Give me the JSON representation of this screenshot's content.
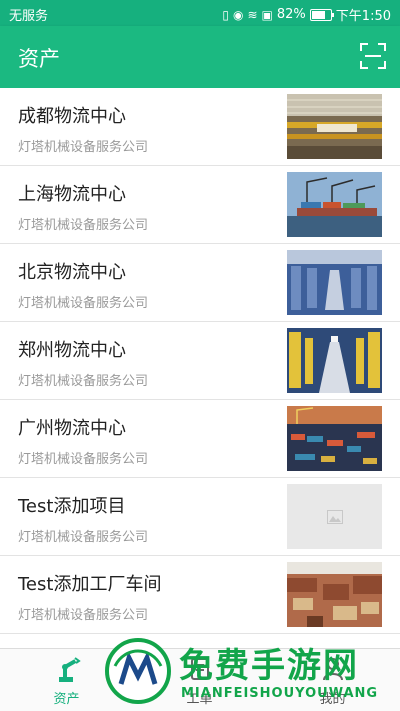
{
  "status_bar": {
    "carrier": "无服务",
    "battery_percent": "82%",
    "battery_level": 0.82,
    "time": "下午1:50"
  },
  "app_bar": {
    "title": "资产"
  },
  "assets": [
    {
      "name": "成都物流中心",
      "company": "灯塔机械设备服务公司",
      "image": "warehouse"
    },
    {
      "name": "上海物流中心",
      "company": "灯塔机械设备服务公司",
      "image": "port-cranes"
    },
    {
      "name": "北京物流中心",
      "company": "灯塔机械设备服务公司",
      "image": "warehouse-racks"
    },
    {
      "name": "郑州物流中心",
      "company": "灯塔机械设备服务公司",
      "image": "warehouse-aisle"
    },
    {
      "name": "广州物流中心",
      "company": "灯塔机械设备服务公司",
      "image": "container-port"
    },
    {
      "name": "Test添加项目",
      "company": "灯塔机械设备服务公司",
      "image": "placeholder"
    },
    {
      "name": "Test添加工厂车间",
      "company": "灯塔机械设备服务公司",
      "image": "town-rooftops"
    }
  ],
  "bottom_nav": [
    {
      "label": "资产",
      "icon": "robot-arm-icon",
      "active": true
    },
    {
      "label": "工单",
      "icon": "work-order-icon",
      "active": false
    },
    {
      "label": "我的",
      "icon": "profile-icon",
      "active": false
    }
  ],
  "watermark": {
    "cn": "免费手游网",
    "en": "MIANFEISHOUYOUWANG"
  },
  "colors": {
    "primary": "#1bb981",
    "statusbar": "#16b07e",
    "watermark": "#12a54a"
  }
}
